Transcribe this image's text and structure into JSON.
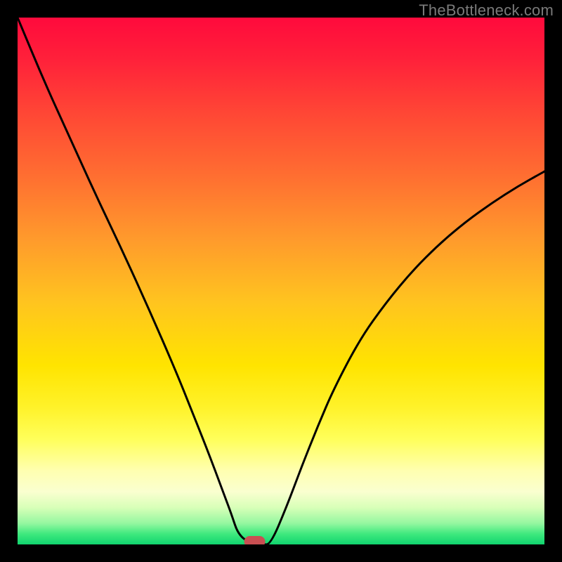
{
  "watermark": "TheBottleneck.com",
  "chart_data": {
    "type": "line",
    "title": "",
    "xlabel": "",
    "ylabel": "",
    "xlim": [
      0,
      1
    ],
    "ylim": [
      0,
      1
    ],
    "series": [
      {
        "name": "bottleneck-curve",
        "x": [
          0.0,
          0.05,
          0.1,
          0.15,
          0.2,
          0.25,
          0.3,
          0.33,
          0.36,
          0.39,
          0.405,
          0.42,
          0.45,
          0.465,
          0.48,
          0.51,
          0.54,
          0.57,
          0.6,
          0.65,
          0.7,
          0.75,
          0.8,
          0.85,
          0.9,
          0.95,
          1.0
        ],
        "values": [
          1.0,
          0.88,
          0.77,
          0.66,
          0.555,
          0.445,
          0.33,
          0.255,
          0.18,
          0.1,
          0.06,
          0.015,
          0.0,
          0.0,
          0.0,
          0.07,
          0.15,
          0.225,
          0.295,
          0.39,
          0.46,
          0.52,
          0.57,
          0.612,
          0.648,
          0.68,
          0.708
        ]
      }
    ],
    "marker": {
      "name": "optimal-point",
      "x": 0.45,
      "y": 0.0,
      "color": "#c94f52"
    },
    "gradient_colors": [
      "#ff0a3c",
      "#ff6e31",
      "#ffe400",
      "#ffff5a",
      "#10d46e"
    ]
  }
}
